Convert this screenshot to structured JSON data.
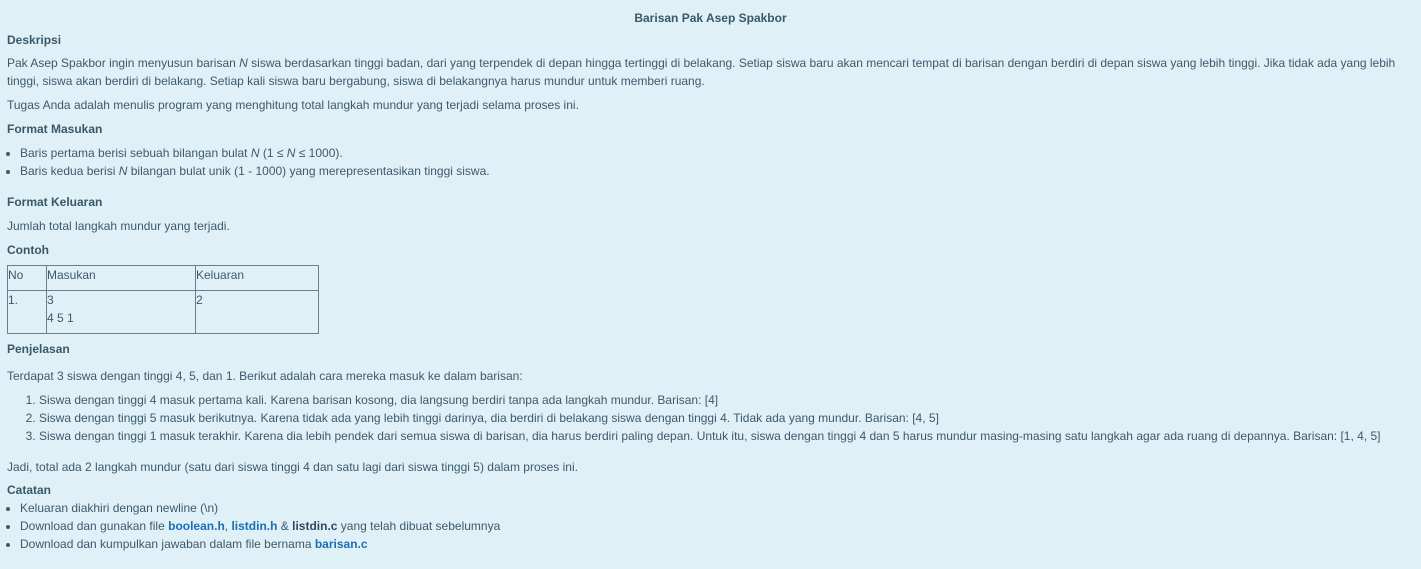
{
  "title": "Barisan Pak Asep Spakbor",
  "description": {
    "heading": "Deskripsi",
    "p1_a": "Pak Asep Spakbor ingin menyusun barisan ",
    "p1_var": "N",
    "p1_b": " siswa berdasarkan tinggi badan, dari yang terpendek di depan hingga tertinggi di belakang. Setiap siswa baru akan mencari tempat di barisan dengan berdiri di depan siswa yang lebih tinggi. Jika tidak ada yang lebih tinggi, siswa akan berdiri di belakang. Setiap kali siswa baru bergabung, siswa di belakangnya harus mundur untuk memberi ruang.",
    "p2": "Tugas Anda adalah menulis program yang menghitung total langkah mundur yang terjadi selama proses ini."
  },
  "input_format": {
    "heading": "Format Masukan",
    "item1_a": "Baris pertama berisi sebuah bilangan bulat ",
    "item1_var": "N",
    "item1_b": " (1 ≤ ",
    "item1_var2": "N",
    "item1_c": " ≤ 1000).",
    "item2_a": "Baris kedua berisi ",
    "item2_var": "N",
    "item2_b": " bilangan bulat unik (1 - 1000) yang merepresentasikan tinggi siswa."
  },
  "output_format": {
    "heading": "Format Keluaran",
    "text": "Jumlah total langkah mundur yang terjadi."
  },
  "example": {
    "heading": "Contoh",
    "columns": [
      "No",
      "Masukan",
      "Keluaran"
    ],
    "rows": [
      {
        "no": "1.",
        "input_line1": "3",
        "input_line2": "4 5 1",
        "output": "2"
      }
    ]
  },
  "explanation": {
    "heading": "Penjelasan",
    "intro": "Terdapat 3 siswa dengan tinggi 4, 5, dan 1. Berikut adalah cara mereka masuk ke dalam barisan:",
    "steps": [
      "Siswa dengan tinggi 4 masuk pertama kali. Karena barisan kosong, dia langsung berdiri tanpa ada langkah mundur. Barisan: [4]",
      "Siswa dengan tinggi 5 masuk berikutnya. Karena tidak ada yang lebih tinggi darinya, dia berdiri di belakang siswa dengan tinggi 4. Tidak ada yang mundur. Barisan: [4, 5]",
      "Siswa dengan tinggi 1 masuk terakhir. Karena dia lebih pendek dari semua siswa di barisan, dia harus berdiri paling depan. Untuk itu, siswa dengan tinggi 4 dan 5 harus mundur masing-masing satu langkah agar ada ruang di depannya. Barisan: [1, 4, 5]"
    ],
    "conclusion": "Jadi, total ada 2 langkah mundur (satu dari siswa tinggi 4 dan satu lagi dari siswa tinggi 5) dalam proses ini."
  },
  "notes": {
    "heading": "Catatan",
    "item1": "Keluaran diakhiri dengan newline (\\n)",
    "item2_a": "Download dan gunakan file ",
    "item2_f1": "boolean.h",
    "item2_sep1": ", ",
    "item2_f2": "listdin.h",
    "item2_sep2": " & ",
    "item2_f3": "listdin.c",
    "item2_b": " yang telah dibuat sebelumnya",
    "item3_a": "Download dan kumpulkan jawaban dalam file bernama ",
    "item3_f": "barisan.c"
  },
  "colors": {
    "background": "#dff0f7",
    "text": "#3d5a6a",
    "link": "#1a6fb5"
  }
}
